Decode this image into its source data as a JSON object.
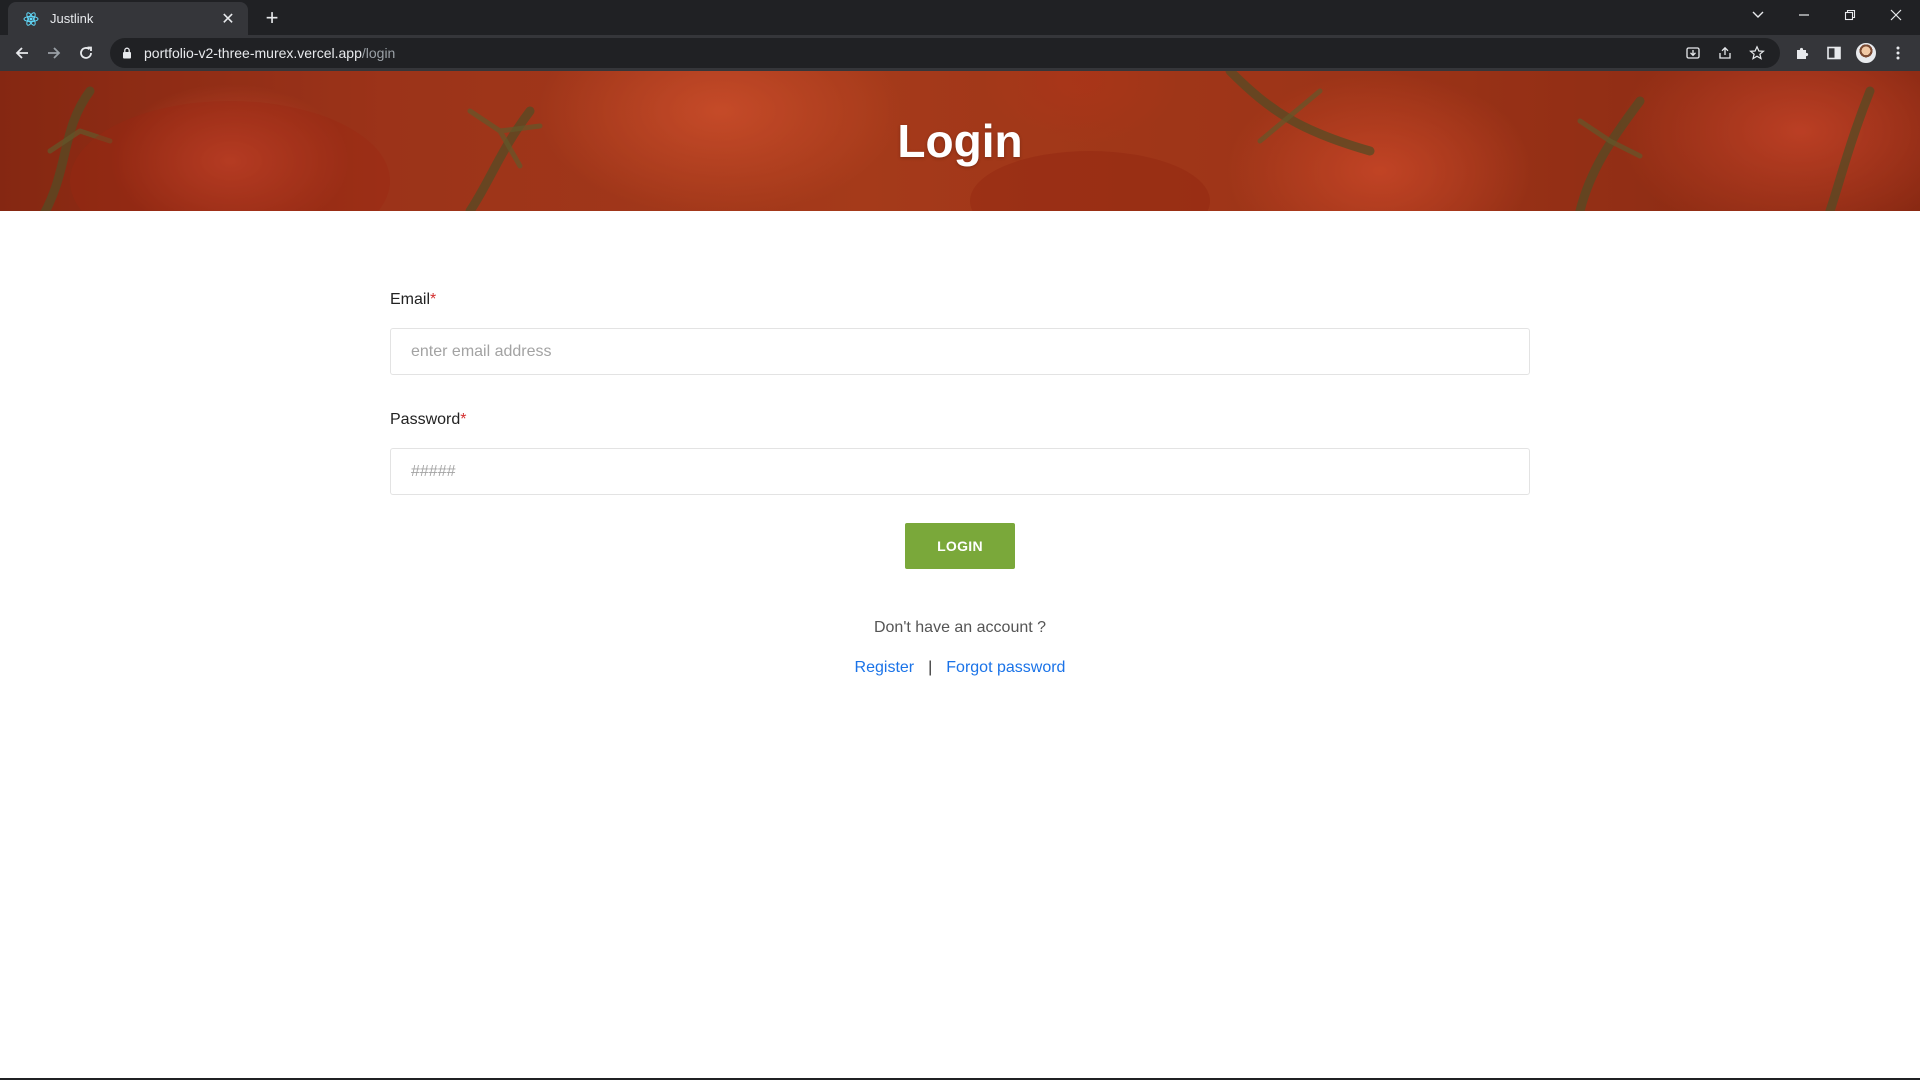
{
  "browser": {
    "tab": {
      "title": "Justlink"
    },
    "url": {
      "host": "portfolio-v2-three-murex.vercel.app",
      "path": "/login"
    }
  },
  "page": {
    "hero": {
      "title": "Login"
    },
    "form": {
      "email": {
        "label": "Email",
        "required_mark": "*",
        "placeholder": "enter email address",
        "value": ""
      },
      "password": {
        "label": "Password",
        "required_mark": "*",
        "placeholder": "#####",
        "value": ""
      },
      "submit_label": "LOGIN"
    },
    "footer": {
      "prompt": "Don't have an account ?",
      "register_label": "Register",
      "separator": "|",
      "forgot_label": "Forgot password"
    }
  },
  "colors": {
    "button": "#7aa83a",
    "link": "#1a73e8",
    "required": "#d32f2f"
  }
}
